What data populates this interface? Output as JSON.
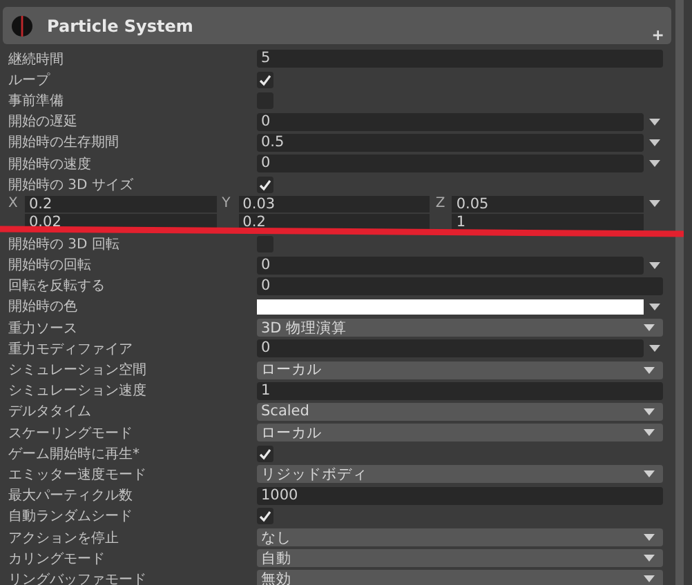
{
  "header": {
    "title": "Particle System",
    "add_symbol": "+"
  },
  "rows": [
    {
      "kind": "field",
      "label": "継続時間",
      "value": "5"
    },
    {
      "kind": "check",
      "label": "ループ",
      "checked": true
    },
    {
      "kind": "check",
      "label": "事前準備",
      "checked": false
    },
    {
      "kind": "curve",
      "label": "開始の遅延",
      "value": "0"
    },
    {
      "kind": "curve",
      "label": "開始時の生存期間",
      "value": "0.5"
    },
    {
      "kind": "curve",
      "label": "開始時の速度",
      "value": "0"
    },
    {
      "kind": "check",
      "label": "開始時の 3D サイズ",
      "checked": true
    },
    {
      "kind": "vector",
      "lines": [
        {
          "components": [
            {
              "axis": "X",
              "value": "0.2"
            },
            {
              "axis": "Y",
              "value": "0.03"
            },
            {
              "axis": "Z",
              "value": "0.05"
            }
          ]
        },
        {
          "components": [
            {
              "value": "0.02"
            },
            {
              "value": "0.2"
            },
            {
              "value": "1"
            }
          ]
        }
      ]
    },
    {
      "kind": "check",
      "label": "開始時の 3D 回転",
      "checked": false
    },
    {
      "kind": "curve",
      "label": "開始時の回転",
      "value": "0"
    },
    {
      "kind": "field",
      "label": "回転を反転する",
      "value": "0"
    },
    {
      "kind": "color",
      "label": "開始時の色",
      "color": "#ffffff"
    },
    {
      "kind": "dropdown",
      "label": "重力ソース",
      "value": "3D 物理演算"
    },
    {
      "kind": "curve",
      "label": "重力モディファイア",
      "value": "0"
    },
    {
      "kind": "dropdown",
      "label": "シミュレーション空間",
      "value": "ローカル"
    },
    {
      "kind": "field",
      "label": "シミュレーション速度",
      "value": "1"
    },
    {
      "kind": "dropdown",
      "label": "デルタタイム",
      "value": "Scaled"
    },
    {
      "kind": "dropdown",
      "label": "スケーリングモード",
      "value": "ローカル"
    },
    {
      "kind": "check",
      "label": "ゲーム開始時に再生*",
      "checked": true
    },
    {
      "kind": "dropdown",
      "label": "エミッター速度モード",
      "value": "リジッドボディ"
    },
    {
      "kind": "field",
      "label": "最大パーティクル数",
      "value": "1000"
    },
    {
      "kind": "check",
      "label": "自動ランダムシード",
      "checked": true
    },
    {
      "kind": "dropdown",
      "label": "アクションを停止",
      "value": "なし"
    },
    {
      "kind": "dropdown",
      "label": "カリングモード",
      "value": "自動"
    },
    {
      "kind": "dropdown",
      "label": "リングバッファモード",
      "value": "無効"
    }
  ]
}
